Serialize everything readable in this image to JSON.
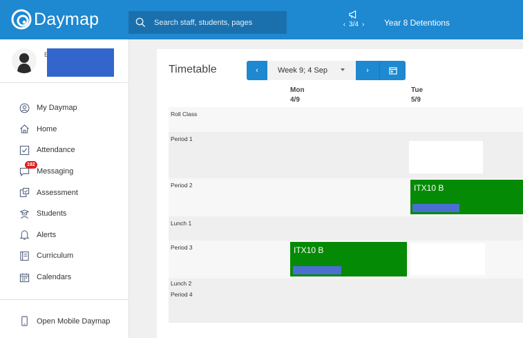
{
  "app": {
    "name": "Daymap"
  },
  "search": {
    "placeholder": "Search staff, students, pages"
  },
  "notice": {
    "prev": "‹",
    "pager": "3/4",
    "next": "›",
    "title": "Year 8 Detentions"
  },
  "profile": {
    "initial": "E"
  },
  "sidebar": {
    "items": [
      {
        "label": "My Daymap",
        "icon": "user-circle-icon"
      },
      {
        "label": "Home",
        "icon": "home-icon"
      },
      {
        "label": "Attendance",
        "icon": "checkbox-icon"
      },
      {
        "label": "Messaging",
        "icon": "message-icon",
        "badge": "192"
      },
      {
        "label": "Assessment",
        "icon": "assessment-icon"
      },
      {
        "label": "Students",
        "icon": "students-icon"
      },
      {
        "label": "Alerts",
        "icon": "bell-icon"
      },
      {
        "label": "Curriculum",
        "icon": "book-icon"
      },
      {
        "label": "Calendars",
        "icon": "calendar-icon"
      }
    ],
    "mobile_label": "Open Mobile Daymap"
  },
  "timetable": {
    "title": "Timetable",
    "prev_label": "‹",
    "week_label": "Week 9; 4 Sep",
    "next_label": "›",
    "days": [
      {
        "name": "Mon",
        "date": "4/9"
      },
      {
        "name": "Tue",
        "date": "5/9"
      }
    ],
    "rows": [
      {
        "label": "Roll Class"
      },
      {
        "label": "Period 1"
      },
      {
        "label": "Period 2"
      },
      {
        "label": "Lunch 1"
      },
      {
        "label": "Period 3"
      },
      {
        "label": "Lunch 2"
      },
      {
        "label": "Period 4"
      }
    ],
    "classes": [
      {
        "day": "Tue",
        "period": "Period 2",
        "code": "ITX10 B"
      },
      {
        "day": "Mon",
        "period": "Period 3",
        "code": "ITX10 B"
      }
    ]
  },
  "colors": {
    "brand": "#1e88d0",
    "class_block": "#058a05",
    "badge": "#e02020"
  }
}
